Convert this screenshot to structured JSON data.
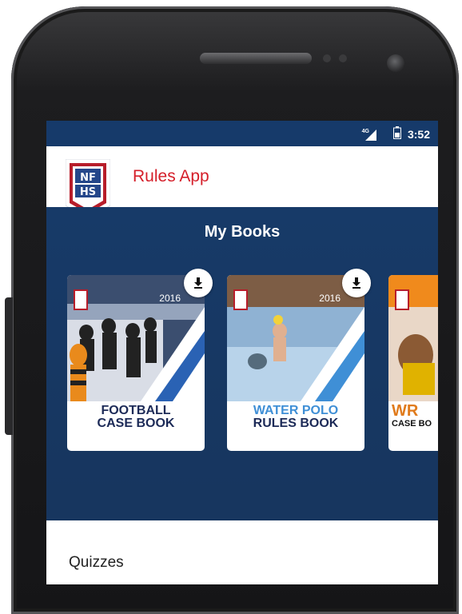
{
  "status_bar": {
    "network": "4G",
    "time": "3:52"
  },
  "app_bar": {
    "logo_text": "NFHS",
    "title": "Rules App"
  },
  "my_books": {
    "heading": "My Books",
    "books": [
      {
        "title_line1": "FOOTBALL",
        "title_line2": "CASE BOOK",
        "year": "2016",
        "title_color": "#1c2a57",
        "accent_color": "#2a62b4"
      },
      {
        "title_line1": "WATER POLO",
        "title_line2": "RULES BOOK",
        "year": "2016",
        "title_color": "#1c2a57",
        "accent_color": "#3f8fd6"
      },
      {
        "title_line1": "WR",
        "title_line2": "CASE BO",
        "title_color": "#e07b1c",
        "accent_color": "#f08a1c"
      }
    ]
  },
  "quizzes": {
    "heading": "Quizzes"
  },
  "icons": [
    "download-icon",
    "signal-icon",
    "battery-icon"
  ]
}
